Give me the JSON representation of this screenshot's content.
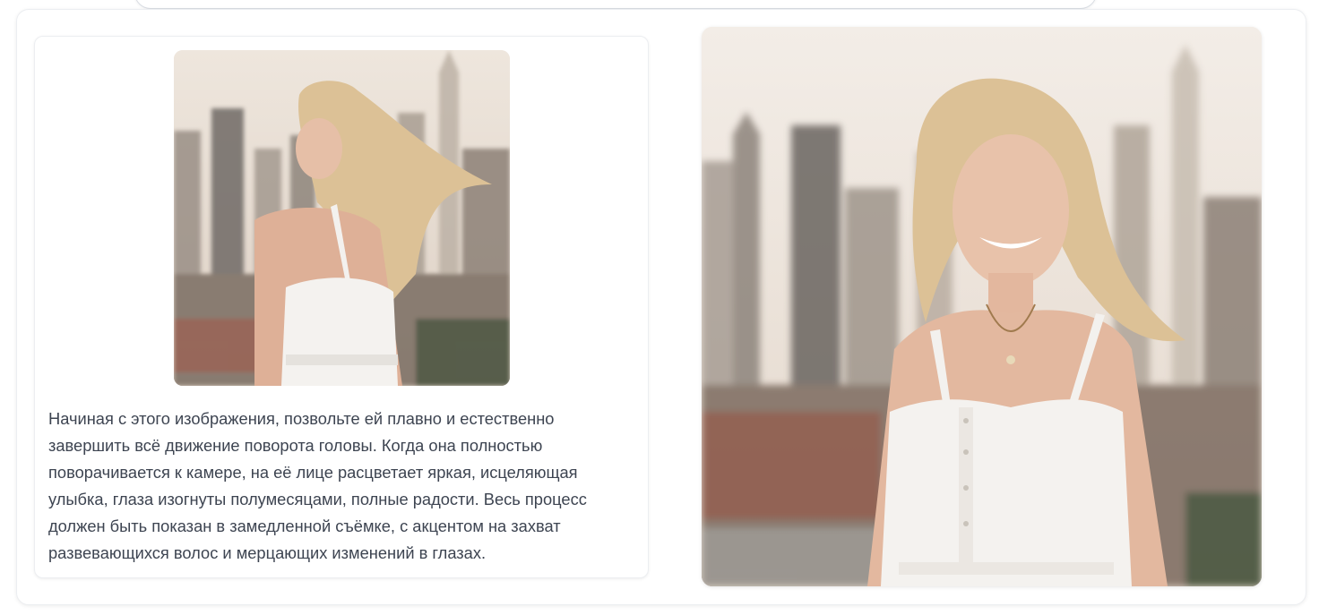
{
  "prompt": {
    "text": "Начиная с этого изображения, позвольте ей плавно и естественно завершить всё движение поворота головы. Когда она полностью поворачивается к камере, на её лице расцветает яркая, исцеляющая улыбка, глаза изогнуты полумесяцами, полные радости. Весь процесс должен быть показан в замедленной съёмке, с акцентом на захват развевающихся волос и мерцающих изменений в глазах."
  },
  "colors": {
    "card_border": "#eceef1",
    "text": "#3d4451",
    "sky": "#eee6de",
    "dress": "#f4f2ef",
    "hair": "#dcc196"
  }
}
